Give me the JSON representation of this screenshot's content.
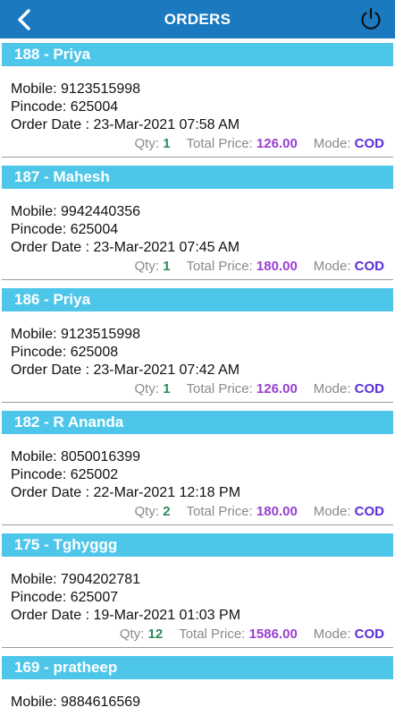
{
  "header": {
    "title": "ORDERS"
  },
  "labels": {
    "mobile": "Mobile: ",
    "pincode": "Pincode: ",
    "order_date": "Order Date : ",
    "qty": "Qty: ",
    "total_price": "Total Price: ",
    "mode": "Mode: "
  },
  "orders": [
    {
      "title": "188 - Priya",
      "mobile": "9123515998",
      "pincode": "625004",
      "date": "23-Mar-2021 07:58 AM",
      "qty": "1",
      "price": "126.00",
      "mode": "COD"
    },
    {
      "title": "187 - Mahesh",
      "mobile": "9942440356",
      "pincode": "625004",
      "date": "23-Mar-2021 07:45 AM",
      "qty": "1",
      "price": "180.00",
      "mode": "COD"
    },
    {
      "title": "186 - Priya",
      "mobile": "9123515998",
      "pincode": "625008",
      "date": "23-Mar-2021 07:42 AM",
      "qty": "1",
      "price": "126.00",
      "mode": "COD"
    },
    {
      "title": "182 - R Ananda",
      "mobile": "8050016399",
      "pincode": "625002",
      "date": "22-Mar-2021 12:18 PM",
      "qty": "2",
      "price": "180.00",
      "mode": "COD"
    },
    {
      "title": "175 - Tghyggg",
      "mobile": "7904202781",
      "pincode": "625007",
      "date": "19-Mar-2021 01:03 PM",
      "qty": "12",
      "price": "1586.00",
      "mode": "COD"
    },
    {
      "title": "169 - pratheep",
      "mobile": "9884616569"
    }
  ]
}
